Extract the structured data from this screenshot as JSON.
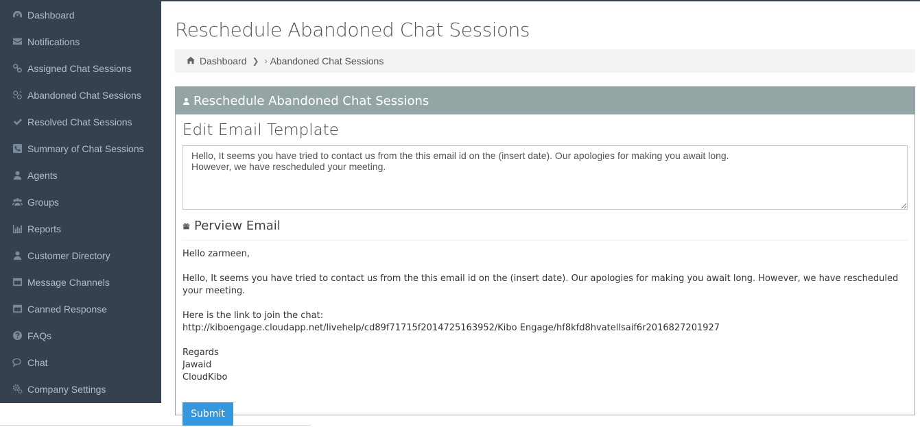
{
  "sidebar": {
    "items": [
      {
        "label": "Dashboard",
        "icon": "dashboard-icon"
      },
      {
        "label": "Notifications",
        "icon": "envelope-icon"
      },
      {
        "label": "Assigned Chat Sessions",
        "icon": "link-icon"
      },
      {
        "label": "Abandoned Chat Sessions",
        "icon": "unlink-icon"
      },
      {
        "label": "Resolved Chat Sessions",
        "icon": "check-icon"
      },
      {
        "label": "Summary of Chat Sessions",
        "icon": "phone-icon"
      },
      {
        "label": "Agents",
        "icon": "user-icon"
      },
      {
        "label": "Groups",
        "icon": "users-icon"
      },
      {
        "label": "Reports",
        "icon": "bar-chart-icon"
      },
      {
        "label": "Customer Directory",
        "icon": "user-icon"
      },
      {
        "label": "Message Channels",
        "icon": "window-icon"
      },
      {
        "label": "Canned Response",
        "icon": "window-icon"
      },
      {
        "label": "FAQs",
        "icon": "question-icon"
      },
      {
        "label": "Chat",
        "icon": "comments-icon"
      },
      {
        "label": "Company Settings",
        "icon": "cogs-icon"
      }
    ]
  },
  "page": {
    "title": "Reschedule Abandoned Chat Sessions"
  },
  "breadcrumb": {
    "home": "Dashboard",
    "current": "Abandoned Chat Sessions"
  },
  "panel": {
    "header": "Reschedule Abandoned Chat Sessions",
    "edit_title": "Edit Email Template",
    "template_text": "Hello, It seems you have tried to contact us from the this email id on the (insert date). Our apologies for making you await long.\nHowever, we have rescheduled your meeting.",
    "preview_title": "Perview Email",
    "preview": {
      "greeting": "Hello zarmeen,",
      "body": "Hello, It seems you have tried to contact us from the this email id on the (insert date). Our apologies for making you await long. However, we have rescheduled your meeting.",
      "link_intro": "Here is the link to join the chat:",
      "link": "http://kiboengage.cloudapp.net/livehelp/cd89f71715f2014725163952/Kibo Engage/hf8kfd8hvatellsaif6r2016827201927",
      "regards": "Regards",
      "name": "Jawaid",
      "company": "CloudKibo"
    },
    "submit_label": "Submit"
  },
  "colors": {
    "sidebar_bg": "#364150",
    "panel_header": "#95a5a6",
    "submit_button": "#3598dc"
  }
}
